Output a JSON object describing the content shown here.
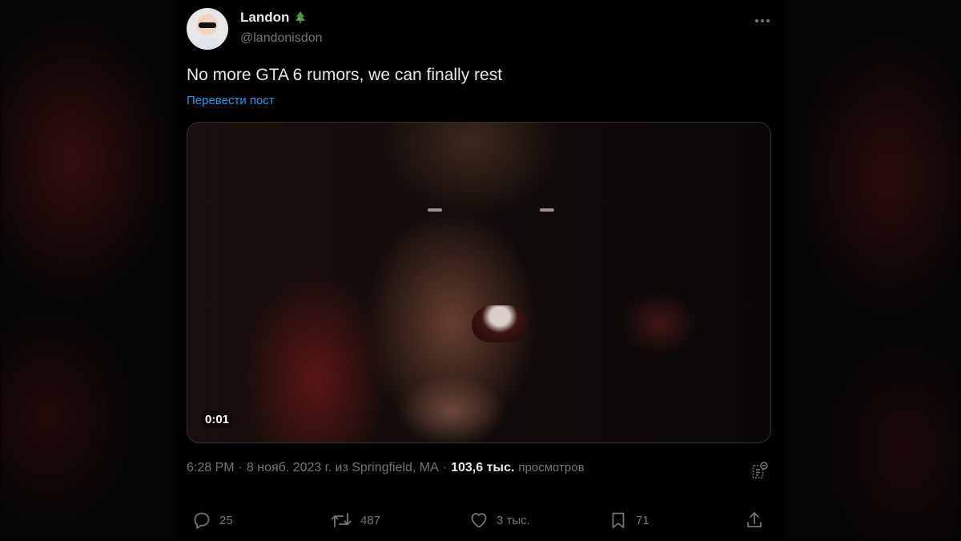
{
  "author": {
    "display_name": "Landon",
    "handle": "@landonisdon",
    "badge_icon": "christmas-tree-icon"
  },
  "tweet": {
    "text": "No more GTA 6 rumors, we can finally rest",
    "translate_link": "Перевести пост"
  },
  "media": {
    "timecode": "0:01"
  },
  "meta": {
    "time": "6:28 PM",
    "separator": "·",
    "date_source": "8 нояб. 2023 г. из Springfield, MA",
    "views_count": "103,6 тыс.",
    "views_label": "просмотров"
  },
  "actions": {
    "replies": "25",
    "retweets": "487",
    "likes": "3 тыс.",
    "bookmarks": "71"
  },
  "colors": {
    "background": "#000000",
    "text_primary": "#e7e9ea",
    "text_secondary": "#71767b",
    "link": "#1d9bf0",
    "border": "#2f3336"
  }
}
